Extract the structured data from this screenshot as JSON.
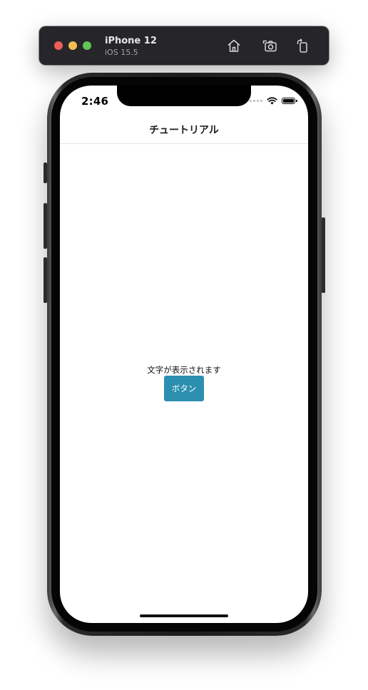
{
  "simulator": {
    "device_name": "iPhone 12",
    "os_version": "iOS 15.5",
    "toolbar_icons": [
      "home-icon",
      "screenshot-icon",
      "rotate-icon"
    ]
  },
  "status_bar": {
    "time": "2:46",
    "icons": [
      "cellular-signal-icon",
      "wifi-icon",
      "battery-icon"
    ]
  },
  "nav": {
    "title": "チュートリアル"
  },
  "main": {
    "label": "文字が表示されます",
    "button_label": "ボタン"
  },
  "colors": {
    "button_background": "#2b8fb0",
    "toolbar_background": "#26252a",
    "traffic_red": "#ed5f56",
    "traffic_yellow": "#f4bf4f",
    "traffic_green": "#61c554"
  }
}
